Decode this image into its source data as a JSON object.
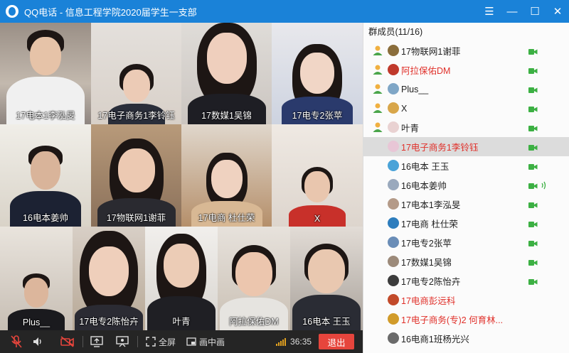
{
  "window": {
    "title": "QQ电话  -  信息工程学院2020届学生一支部",
    "controls": {
      "menu": "☰",
      "minimize": "—",
      "maximize": "☐",
      "close": "✕"
    }
  },
  "videos": [
    {
      "label": "17电本1李泓旻"
    },
    {
      "label": "17电子商务1李铃钰"
    },
    {
      "label": "17数媒1吴锦"
    },
    {
      "label": "17电专2张苹"
    },
    {
      "label": "16电本姜帅"
    },
    {
      "label": "17物联网1谢菲"
    },
    {
      "label": "17电商 杜仕荣"
    },
    {
      "label": "X"
    },
    {
      "label": "Plus__"
    },
    {
      "label": "17电专2陈怡卉"
    },
    {
      "label": "叶青"
    },
    {
      "label": "阿拉保佑DM"
    },
    {
      "label": "16电本 王玉"
    }
  ],
  "toolbar": {
    "fullscreen_label": "全屏",
    "pip_label": "画中画",
    "duration": "36:35",
    "hangup_label": "退出"
  },
  "members": {
    "header": "群成员(11/16)",
    "list": [
      {
        "name": "17物联网1谢菲",
        "red": false,
        "role": "host",
        "camera": true,
        "speaking": false
      },
      {
        "name": "阿拉保佑DM",
        "red": true,
        "role": "host",
        "camera": true,
        "speaking": false
      },
      {
        "name": "Plus__",
        "red": false,
        "role": "host",
        "camera": true,
        "speaking": false
      },
      {
        "name": "X",
        "red": false,
        "role": "host",
        "camera": true,
        "speaking": false
      },
      {
        "name": "叶青",
        "red": false,
        "role": "host",
        "camera": true,
        "speaking": false
      },
      {
        "name": "17电子商务1李铃钰",
        "red": true,
        "role": "",
        "camera": true,
        "speaking": false,
        "selected": true
      },
      {
        "name": "16电本 王玉",
        "red": false,
        "role": "",
        "camera": true,
        "speaking": false
      },
      {
        "name": "16电本姜帅",
        "red": false,
        "role": "",
        "camera": true,
        "speaking": true
      },
      {
        "name": "17电本1李泓旻",
        "red": false,
        "role": "",
        "camera": true,
        "speaking": false
      },
      {
        "name": "17电商 杜仕荣",
        "red": false,
        "role": "",
        "camera": true,
        "speaking": false
      },
      {
        "name": "17电专2张苹",
        "red": false,
        "role": "",
        "camera": true,
        "speaking": false
      },
      {
        "name": "17数媒1吴锦",
        "red": false,
        "role": "",
        "camera": true,
        "speaking": false
      },
      {
        "name": "17电专2陈怡卉",
        "red": false,
        "role": "",
        "camera": true,
        "speaking": false
      },
      {
        "name": "17电商彭远科",
        "red": true,
        "role": "",
        "camera": false,
        "speaking": false
      },
      {
        "name": "17电子商务(专)2  何育林...",
        "red": true,
        "role": "",
        "camera": false,
        "speaking": false
      },
      {
        "name": "16电商1班杨光兴",
        "red": false,
        "role": "",
        "camera": false,
        "speaking": false
      }
    ]
  },
  "colors": {
    "titlebar": "#1a82d8",
    "camera_green": "#3cb043",
    "hangup_red": "#e6453c",
    "highlight_red": "#e0302a"
  }
}
